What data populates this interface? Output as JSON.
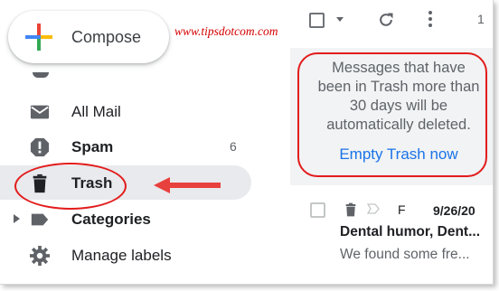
{
  "compose": {
    "label": "Compose"
  },
  "watermark": "www.tipsdotcom.com",
  "sidebar": {
    "items": [
      {
        "label": "All Mail",
        "icon": "mail-icon"
      },
      {
        "label": "Spam",
        "icon": "spam-icon",
        "count": "6"
      },
      {
        "label": "Trash",
        "icon": "trash-icon"
      },
      {
        "label": "Categories",
        "icon": "label-icon"
      },
      {
        "label": "Manage labels",
        "icon": "gear-icon"
      }
    ]
  },
  "toolbar": {
    "count": "1"
  },
  "trash_notice": {
    "line1": "Messages that have",
    "line2": "been in Trash more than",
    "line3": "30 days will be",
    "line4": "automatically deleted.",
    "link": "Empty Trash now"
  },
  "message": {
    "sender": "F",
    "date": "9/26/20",
    "subject": "Dental humor, Dent...",
    "snippet": "We found some fre..."
  },
  "colors": {
    "annotation_red": "#e31c1c",
    "link_blue": "#1a73e8",
    "active_bg": "#e8eaed",
    "notice_bg": "#f1f3f4"
  }
}
